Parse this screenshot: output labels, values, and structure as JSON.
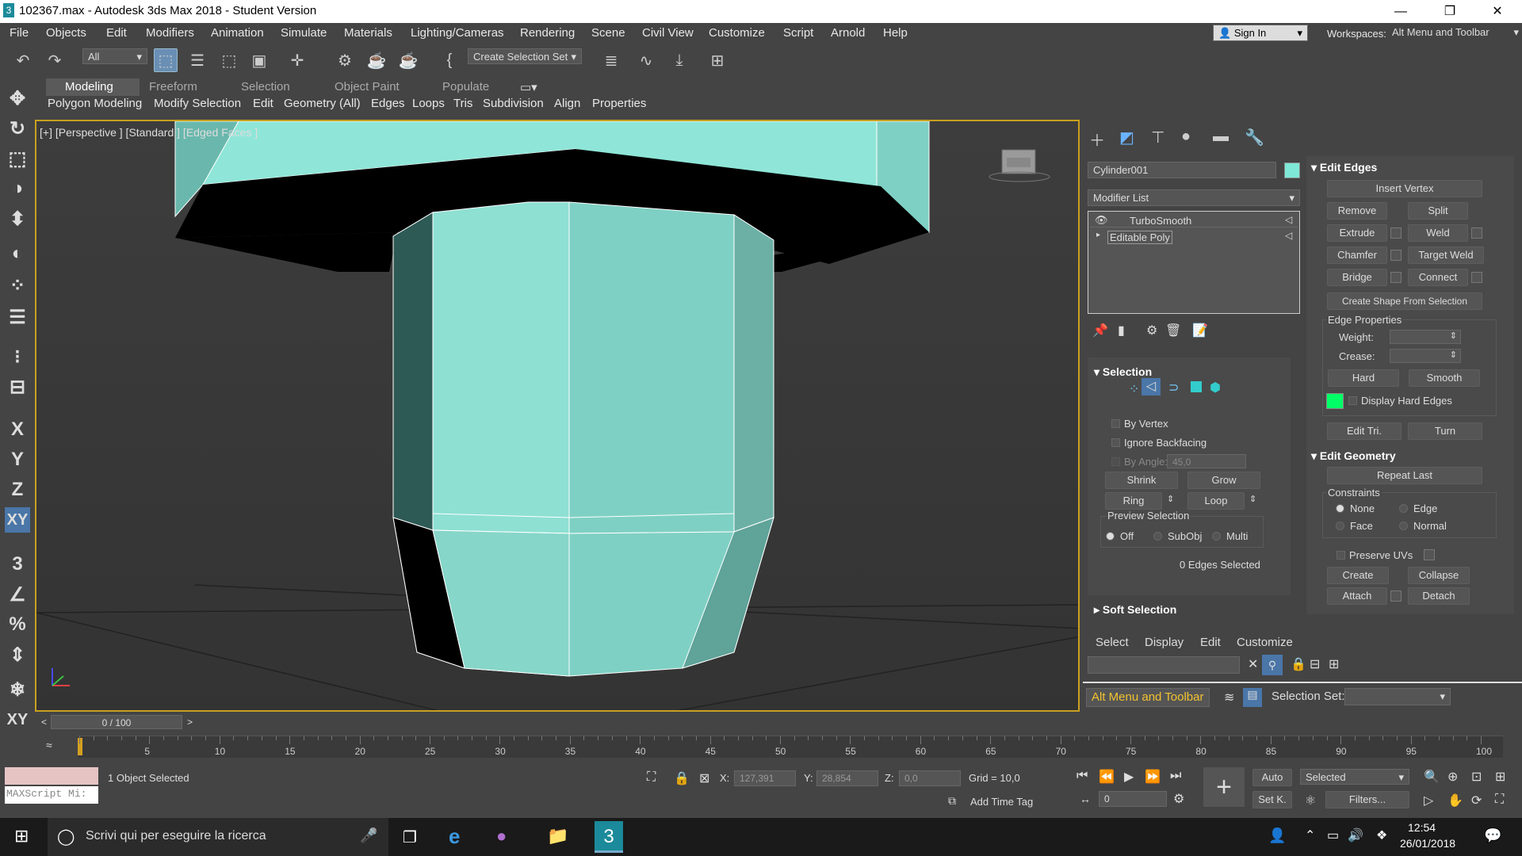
{
  "window": {
    "title": "102367.max - Autodesk 3ds Max 2018 - Student Version",
    "app_icon": "3",
    "min": "—",
    "max": "❐",
    "close": "✕"
  },
  "menu": [
    "File",
    "Objects",
    "Edit",
    "Modifiers",
    "Animation",
    "Simulate",
    "Materials",
    "Lighting/Cameras",
    "Rendering",
    "Scene",
    "Civil View",
    "Customize",
    "Script",
    "Arnold",
    "Help"
  ],
  "account": {
    "signin": "Sign In",
    "workspaces_label": "Workspaces:",
    "workspace": "Alt Menu and Toolbar"
  },
  "toolbar": {
    "filter": "All",
    "selection_set": "Create Selection Set"
  },
  "ribbon": {
    "tabs": [
      "Modeling",
      "Freeform",
      "Selection",
      "Object Paint",
      "Populate"
    ],
    "subtabs": [
      "Polygon Modeling",
      "Modify Selection",
      "Edit",
      "Geometry (All)",
      "Edges",
      "Loops",
      "Tris",
      "Subdivision",
      "Align",
      "Properties"
    ]
  },
  "left_tools": [
    "✥",
    "↻",
    "⬚",
    "◑",
    "⬍",
    "◐",
    "⁘",
    "☰",
    "⁝",
    "⊟",
    "X",
    "Y",
    "Z",
    "XY",
    "3",
    "∠",
    "%",
    "⇕",
    "❄",
    "XY"
  ],
  "viewport": {
    "label": "[+] [Perspective ] [Standard ] [Edged Faces ]",
    "mesh_color": "#7fd0c4",
    "axis_x": "x",
    "axis_y": "y",
    "cube": "FRONT"
  },
  "panel": {
    "object_name": "Cylinder001",
    "object_color": "#7fe8d6",
    "modifier_list": "Modifier List",
    "stack": [
      "TurboSmooth",
      "Editable Poly"
    ],
    "selection": {
      "header": "Selection",
      "by_vertex": "By Vertex",
      "ignore_backfacing": "Ignore Backfacing",
      "by_angle": "By Angle:",
      "angle_value": "45,0",
      "shrink": "Shrink",
      "grow": "Grow",
      "ring": "Ring",
      "loop": "Loop",
      "preview": "Preview Selection",
      "off": "Off",
      "subobj": "SubObj",
      "multi": "Multi",
      "count": "0 Edges Selected"
    },
    "soft_selection": "Soft Selection",
    "edit_edges": {
      "header": "Edit Edges",
      "insert_vertex": "Insert Vertex",
      "remove": "Remove",
      "split": "Split",
      "extrude": "Extrude",
      "weld": "Weld",
      "chamfer": "Chamfer",
      "target_weld": "Target Weld",
      "bridge": "Bridge",
      "connect": "Connect",
      "create_shape": "Create Shape From Selection",
      "edge_props": "Edge Properties",
      "weight": "Weight:",
      "crease": "Crease:",
      "hard": "Hard",
      "smooth": "Smooth",
      "display_hard": "Display Hard Edges",
      "edit_tri": "Edit Tri.",
      "turn": "Turn",
      "hard_color": "#00ff66"
    },
    "edit_geometry": {
      "header": "Edit Geometry",
      "repeat_last": "Repeat Last",
      "constraints": "Constraints",
      "none": "None",
      "edge": "Edge",
      "face": "Face",
      "normal": "Normal",
      "preserve_uvs": "Preserve UVs",
      "create": "Create",
      "collapse": "Collapse",
      "attach": "Attach",
      "detach": "Detach"
    }
  },
  "scene_explorer": {
    "menu": [
      "Select",
      "Display",
      "Edit",
      "Customize"
    ],
    "workspace": "Alt Menu and Toolbar",
    "selection_set_label": "Selection Set:"
  },
  "timeline": {
    "frame": "0 / 100",
    "ticks": [
      "5",
      "10",
      "15",
      "20",
      "25",
      "30",
      "35",
      "40",
      "45",
      "50",
      "55",
      "60",
      "65",
      "70",
      "75",
      "80",
      "85",
      "90",
      "95",
      "100"
    ]
  },
  "status": {
    "maxscript": "MAXScript Mi:",
    "selected": "1 Object Selected",
    "x_label": "X:",
    "x": "127,391",
    "y_label": "Y:",
    "y": "28,854",
    "z_label": "Z:",
    "z": "0,0",
    "grid": "Grid = 10,0",
    "add_time_tag": "Add Time Tag",
    "auto": "Auto",
    "set_k": "Set K.",
    "selected_dd": "Selected",
    "filters": "Filters...",
    "frame_field": "0"
  },
  "taskbar": {
    "search": "Scrivi qui per eseguire la ricerca",
    "time": "12:54",
    "date": "26/01/2018"
  }
}
